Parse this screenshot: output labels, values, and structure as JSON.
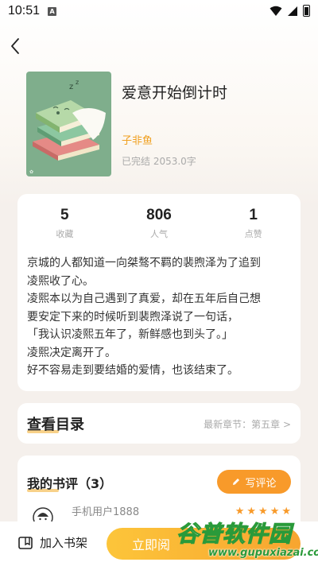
{
  "status_bar": {
    "time": "10:51",
    "notification_letter": "A"
  },
  "book": {
    "title": "爱意开始倒计时",
    "author": "子非鱼",
    "status": "已完结 2053.0字"
  },
  "stats": [
    {
      "value": "5",
      "label": "收藏"
    },
    {
      "value": "806",
      "label": "人气"
    },
    {
      "value": "1",
      "label": "点赞"
    }
  ],
  "intro": [
    "京城的人都知道一向桀骜不羁的裴煦泽为了追到",
    "凌熙收了心。",
    "凌熙本以为自己遇到了真爱，却在五年后自己想",
    "要安定下来的时候听到裴煦泽说了一句话，",
    "「我认识凌熙五年了，新鲜感也到头了。」",
    "凌熙决定离开了。",
    "好不容易走到要结婚的爱情，也该结束了。"
  ],
  "catalog": {
    "title": "查看目录",
    "latest": "最新章节：第五章 >"
  },
  "reviews": {
    "title": "我的书评（3）",
    "write_button": "写评论",
    "items": [
      {
        "user": "手机用户1888",
        "rating": 5
      }
    ]
  },
  "bottom_bar": {
    "add_shelf": "加入书架",
    "read_now": "立即阅"
  },
  "watermark": {
    "title": "谷普软件园",
    "url": "www.gupuxiazai.com"
  },
  "colors": {
    "accent": "#f89a2a",
    "author": "#f0a020",
    "read_button": "#fcc53a"
  }
}
